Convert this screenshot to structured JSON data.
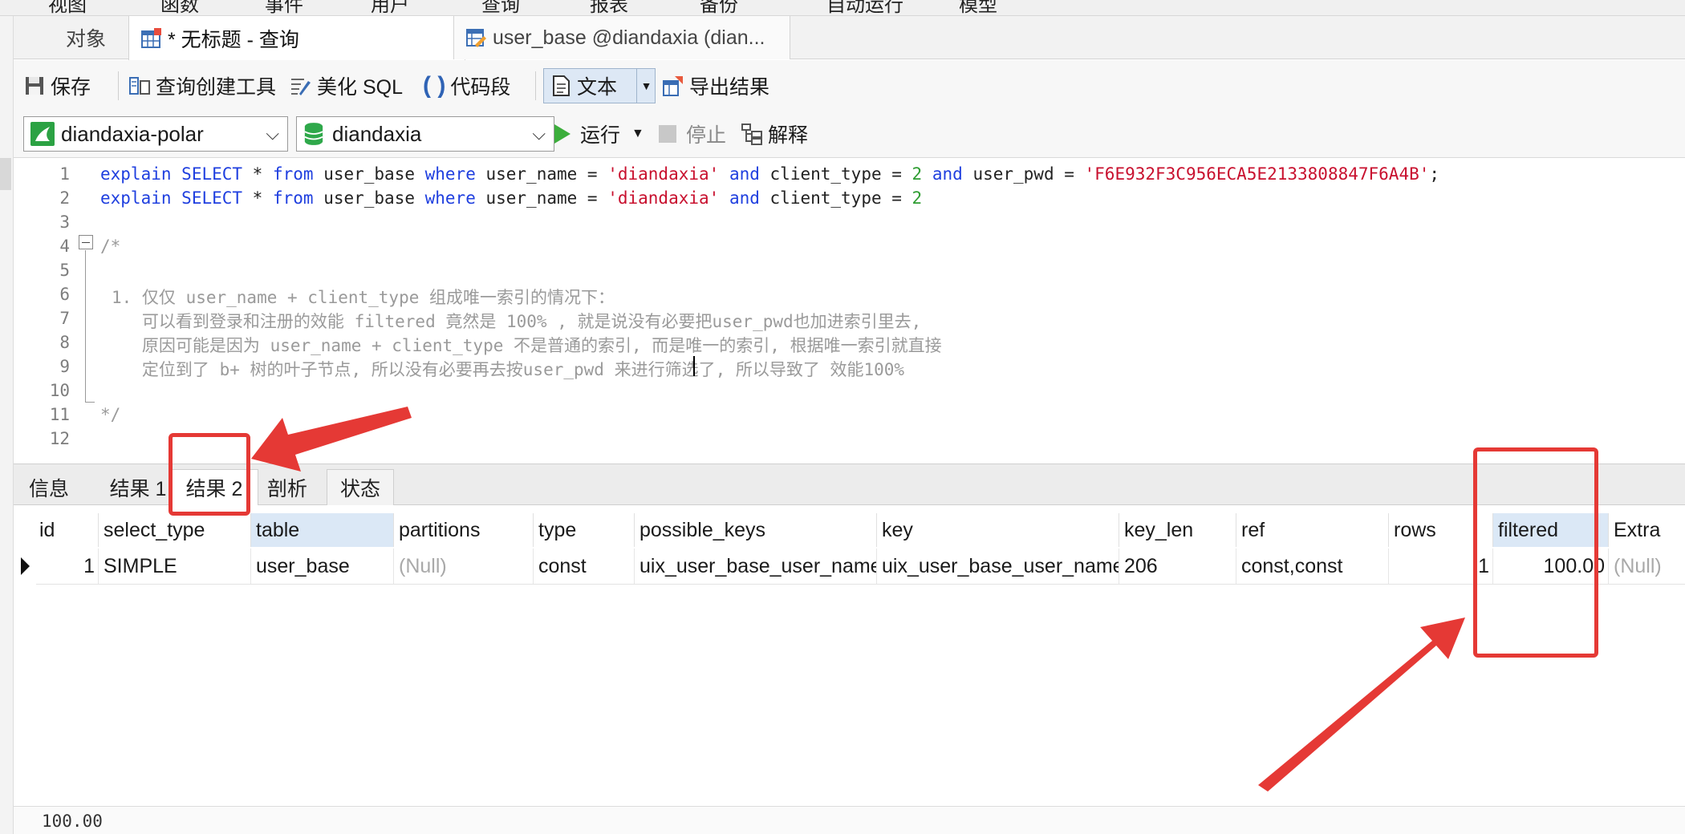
{
  "menu": {
    "items": [
      "视图",
      "函数",
      "事件",
      "用户",
      "查询",
      "报表",
      "备份",
      "自动运行",
      "模型"
    ]
  },
  "tabs": [
    {
      "label": "对象"
    },
    {
      "label": "* 无标题 - 查询"
    },
    {
      "label": "user_base @diandaxia (dian..."
    }
  ],
  "toolbar": {
    "save": "保存",
    "query_builder": "查询创建工具",
    "beautify": "美化 SQL",
    "snippet": "代码段",
    "text": "文本",
    "export": "导出结果"
  },
  "connection": {
    "server": "diandaxia-polar",
    "database": "diandaxia",
    "run": "运行",
    "stop": "停止",
    "explain": "解释"
  },
  "editor": {
    "line_numbers": [
      "1",
      "2",
      "3",
      "4",
      "5",
      "6",
      "7",
      "8",
      "9",
      "10",
      "11",
      "12"
    ],
    "line1": {
      "k1": "explain",
      "k2": "SELECT",
      "t1": " * ",
      "k3": "from",
      "t2": " user_base ",
      "k4": "where",
      "t3": " user_name = ",
      "s1": "'diandaxia'",
      "t4": " ",
      "k5": "and",
      "t5": " client_type = ",
      "n1": "2",
      "t6": " ",
      "k6": "and",
      "t7": " user_pwd = ",
      "s2": "'F6E932F3C956ECA5E2133808847F6A4B'",
      "t8": ";"
    },
    "line2": {
      "k1": "explain",
      "k2": "SELECT",
      "t1": " * ",
      "k3": "from",
      "t2": " user_base ",
      "k4": "where",
      "t3": " user_name = ",
      "s1": "'diandaxia'",
      "t4": " ",
      "k5": "and",
      "t5": " client_type = ",
      "n1": "2"
    },
    "comment_open": "/*",
    "comment_lines": [
      "1. 仅仅 user_name + client_type 组成唯一索引的情况下：",
      "   可以看到登录和注册的效能 filtered 竟然是 100% , 就是说没有必要把user_pwd也加进索引里去,",
      "   原因可能是因为 user_name + client_type 不是普通的索引, 而是唯一的索引, 根据唯一索引就直接",
      "   定位到了 b+ 树的叶子节点, 所以没有必要再去按user_pwd 来进行筛选了, 所以导致了 效能100%"
    ],
    "comment_close": "*/"
  },
  "result_tabs": [
    "信息",
    "结果 1",
    "结果 2",
    "剖析",
    "状态"
  ],
  "grid": {
    "columns": [
      "id",
      "select_type",
      "table",
      "partitions",
      "type",
      "possible_keys",
      "key",
      "key_len",
      "ref",
      "rows",
      "filtered",
      "Extra"
    ],
    "row": {
      "id": "1",
      "select_type": "SIMPLE",
      "table": "user_base",
      "partitions": "(Null)",
      "type": "const",
      "possible_keys": "uix_user_base_user_name_",
      "key": "uix_user_base_user_name_",
      "key_len": "206",
      "ref": "const,const",
      "rows": "1",
      "filtered": "100.00",
      "extra": "(Null)"
    }
  },
  "status": {
    "value": "100.00"
  },
  "colors": {
    "annotation": "#e53935",
    "keyword": "#1f3fdf",
    "string": "#c8102e",
    "number": "#2f9d32"
  }
}
